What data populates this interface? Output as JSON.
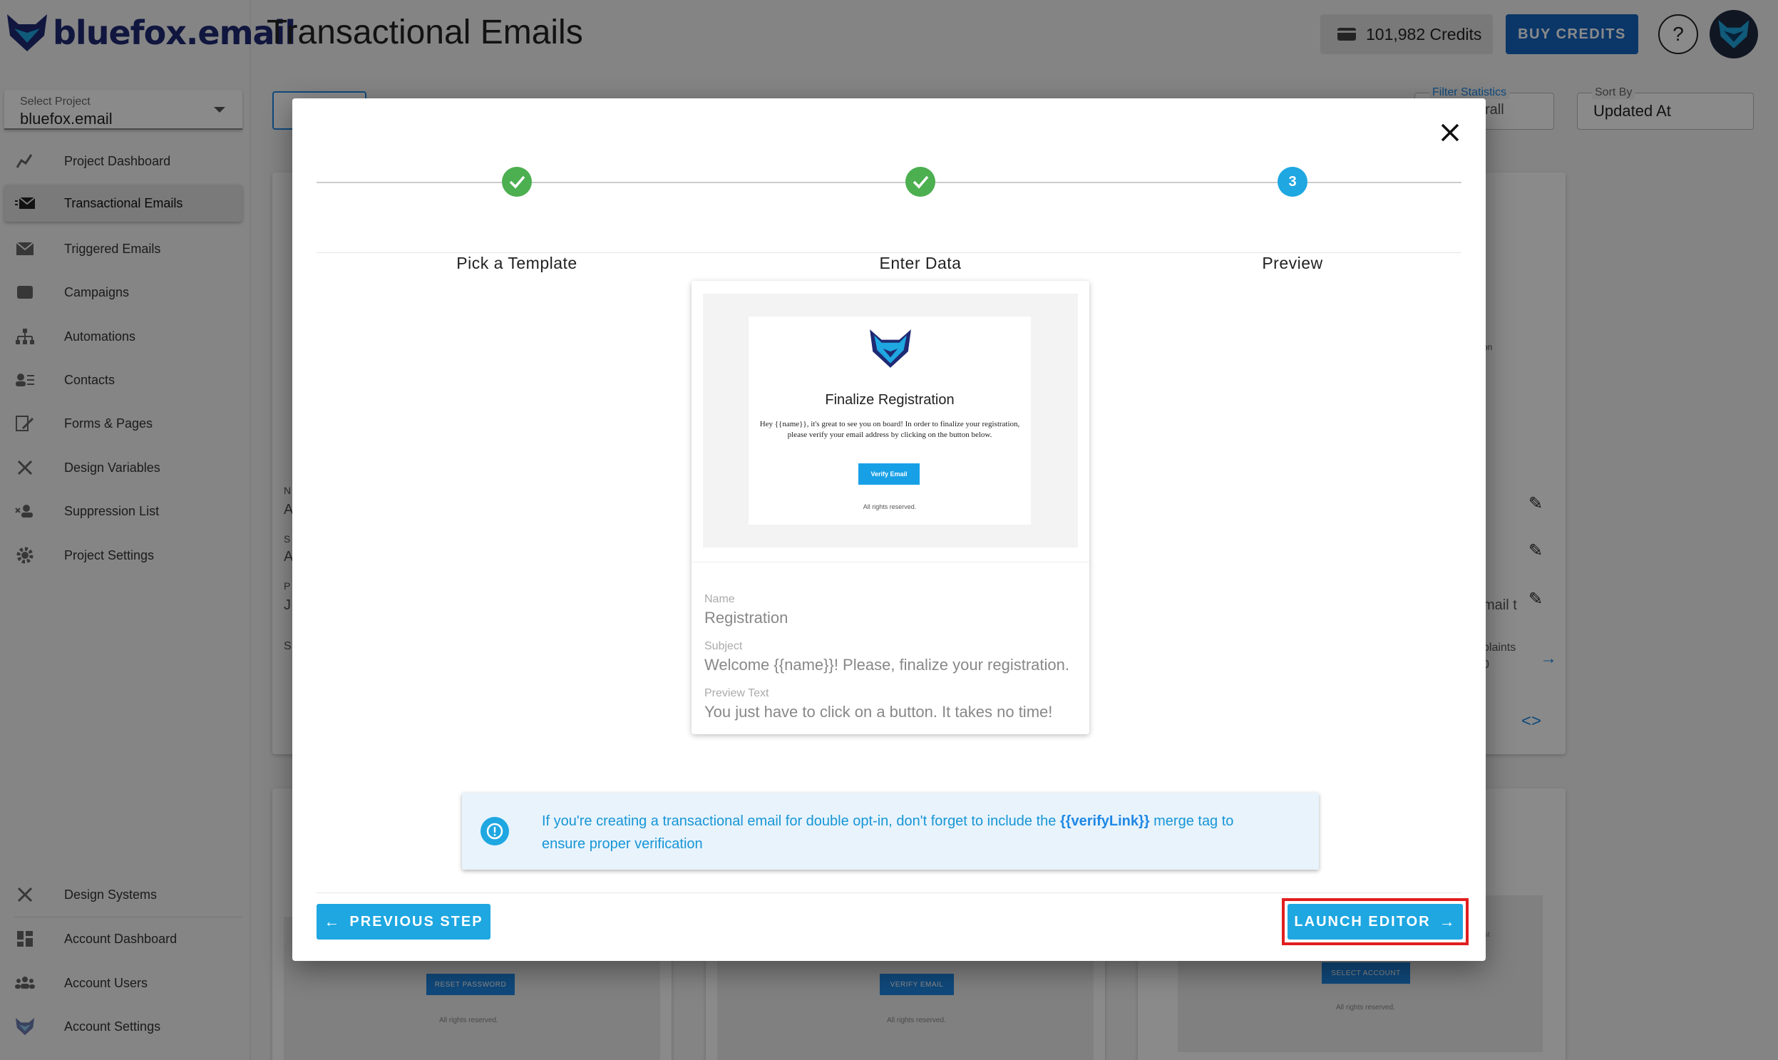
{
  "app": {
    "logo_text": "bluefox.email",
    "page_title": "Transactional Emails"
  },
  "header": {
    "credits": "101,982 Credits",
    "buy_credits": "BUY CREDITS",
    "help": "?"
  },
  "project_select": {
    "label": "Select Project",
    "value": "bluefox.email"
  },
  "sidebar": {
    "items": [
      {
        "label": "Project Dashboard",
        "icon": "dashboard-chart-icon"
      },
      {
        "label": "Transactional Emails",
        "icon": "email-send-icon",
        "active": true
      },
      {
        "label": "Triggered Emails",
        "icon": "envelope-icon"
      },
      {
        "label": "Campaigns",
        "icon": "campaign-icon"
      },
      {
        "label": "Automations",
        "icon": "sitemap-icon"
      },
      {
        "label": "Contacts",
        "icon": "contacts-icon"
      },
      {
        "label": "Forms & Pages",
        "icon": "form-edit-icon"
      },
      {
        "label": "Design Variables",
        "icon": "design-tools-icon"
      },
      {
        "label": "Suppression List",
        "icon": "user-remove-icon"
      },
      {
        "label": "Project Settings",
        "icon": "gear-icon"
      }
    ],
    "bottom_items": [
      {
        "label": "Design Systems",
        "icon": "design-tools-icon"
      },
      {
        "label": "Account Dashboard",
        "icon": "grid-dashboard-icon"
      },
      {
        "label": "Account Users",
        "icon": "users-icon"
      },
      {
        "label": "Account Settings",
        "icon": "fox-logo-icon"
      }
    ]
  },
  "background": {
    "filter_label": "Filter Statistics",
    "filter_value": "rall",
    "sort_label": "Sort By",
    "sort_value": "Updated At",
    "card_btns": [
      "RESET PASSWORD",
      "VERIFY EMAIL",
      "SELECT ACCOUNT"
    ],
    "card_footer": "All rights reserved.",
    "snips": [
      "on",
      "mail t",
      "plaints",
      "0",
      "N",
      "A",
      "S",
      "A",
      "P",
      "J",
      "S",
      "st"
    ]
  },
  "dialog": {
    "steps": [
      {
        "label": "Pick a Template",
        "state": "done"
      },
      {
        "label": "Enter Data",
        "state": "done"
      },
      {
        "label": "Preview",
        "state": "current",
        "number": "3"
      }
    ],
    "template": {
      "heading": "Finalize Registration",
      "body": "Hey {{name}}, it's great to see you on board! In order to finalize your registration, please verify your email address by clicking on the button below.",
      "button": "Verify Email",
      "footer": "All rights reserved."
    },
    "fields": {
      "name_label": "Name",
      "name_value": "Registration",
      "subject_label": "Subject",
      "subject_value": "Welcome {{name}}! Please, finalize your registration.",
      "preview_label": "Preview Text",
      "preview_value": "You just have to click on a button. It takes no time!"
    },
    "alert": {
      "text_before": "If you're creating a transactional email for double opt-in, don't forget to include the ",
      "merge_tag": "{{verifyLink}}",
      "text_after": " merge tag to ensure proper verification"
    },
    "prev_button": "PREVIOUS STEP",
    "launch_button": "LAUNCH EDITOR"
  },
  "colors": {
    "brand": "#1f2a73",
    "primary": "#1ea7e1",
    "buy_button": "#1565c0",
    "success": "#4caf50",
    "highlight": "#e01e1e"
  }
}
